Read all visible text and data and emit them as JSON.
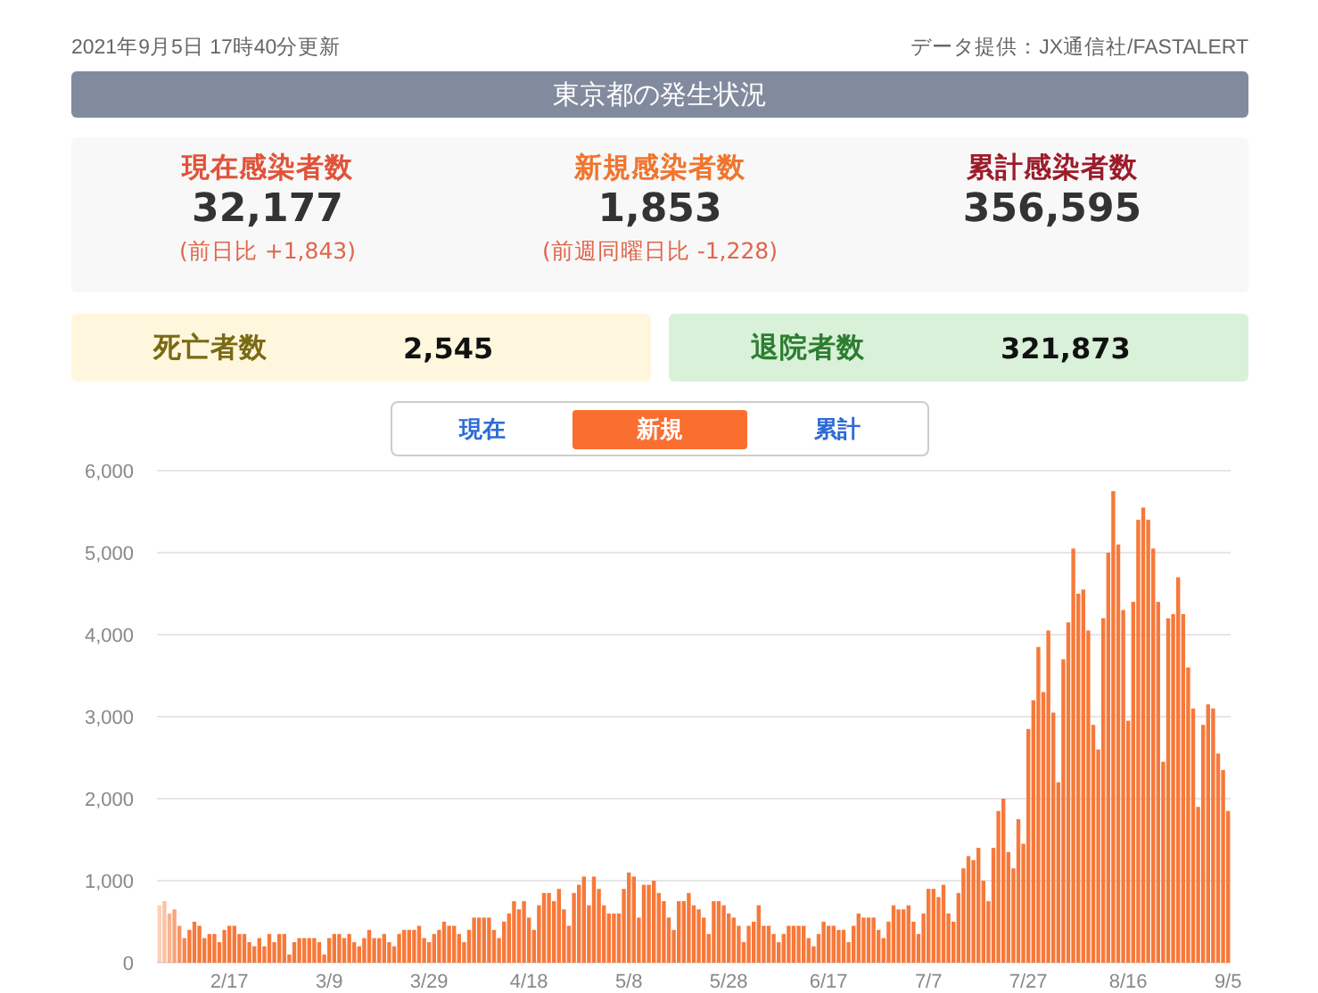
{
  "updated": "2021年9月5日 17時40分更新",
  "source": "データ提供：JX通信社/FASTALERT",
  "title": "東京都の発生状況",
  "stats": [
    {
      "kind": "active",
      "label": "現在感染者数",
      "value": "32,177",
      "note": "(前日比 +1,843)"
    },
    {
      "kind": "new",
      "label": "新規感染者数",
      "value": "1,853",
      "note": "(前週同曜日比 -1,228)"
    },
    {
      "kind": "total",
      "label": "累計感染者数",
      "value": "356,595"
    }
  ],
  "summary": [
    {
      "kind": "deaths",
      "label": "死亡者数",
      "value": "2,545"
    },
    {
      "kind": "discharged",
      "label": "退院者数",
      "value": "321,873"
    }
  ],
  "tabs": [
    {
      "label": "現在",
      "selected": false
    },
    {
      "label": "新規",
      "selected": true
    },
    {
      "label": "累計",
      "selected": false
    }
  ],
  "chart": {
    "chart_data": {
      "type": "bar",
      "grid": true,
      "ylim": [
        0,
        6000
      ],
      "yticks": [
        {
          "value": 0,
          "label": "0"
        },
        {
          "value": 1000,
          "label": "1,000"
        },
        {
          "value": 2000,
          "label": "2,000"
        },
        {
          "value": 3000,
          "label": "3,000"
        },
        {
          "value": 4000,
          "label": "4,000"
        },
        {
          "value": 5000,
          "label": "5,000"
        },
        {
          "value": 6000,
          "label": "6,000"
        }
      ],
      "categories": [
        null,
        null,
        null,
        null,
        null,
        null,
        null,
        null,
        null,
        null,
        null,
        null,
        null,
        null,
        "2/17",
        null,
        null,
        null,
        null,
        null,
        null,
        null,
        null,
        null,
        null,
        null,
        null,
        null,
        null,
        null,
        null,
        null,
        null,
        null,
        "3/9",
        null,
        null,
        null,
        null,
        null,
        null,
        null,
        null,
        null,
        null,
        null,
        null,
        null,
        null,
        null,
        null,
        null,
        null,
        null,
        "3/29",
        null,
        null,
        null,
        null,
        null,
        null,
        null,
        null,
        null,
        null,
        null,
        null,
        null,
        null,
        null,
        null,
        null,
        null,
        null,
        "4/18",
        null,
        null,
        null,
        null,
        null,
        null,
        null,
        null,
        null,
        null,
        null,
        null,
        null,
        null,
        null,
        null,
        null,
        null,
        null,
        "5/8",
        null,
        null,
        null,
        null,
        null,
        null,
        null,
        null,
        null,
        null,
        null,
        null,
        null,
        null,
        null,
        null,
        null,
        null,
        null,
        "5/28",
        null,
        null,
        null,
        null,
        null,
        null,
        null,
        null,
        null,
        null,
        null,
        null,
        null,
        null,
        null,
        null,
        null,
        null,
        null,
        "6/17",
        null,
        null,
        null,
        null,
        null,
        null,
        null,
        null,
        null,
        null,
        null,
        null,
        null,
        null,
        null,
        null,
        null,
        null,
        null,
        "7/7",
        null,
        null,
        null,
        null,
        null,
        null,
        null,
        null,
        null,
        null,
        null,
        null,
        null,
        null,
        null,
        null,
        null,
        null,
        null,
        "7/27",
        null,
        null,
        null,
        null,
        null,
        null,
        null,
        null,
        null,
        null,
        null,
        null,
        null,
        null,
        null,
        null,
        null,
        null,
        null,
        "8/16",
        null,
        null,
        null,
        null,
        null,
        null,
        null,
        null,
        null,
        null,
        null,
        null,
        null,
        null,
        null,
        null,
        null,
        null,
        null,
        "9/5"
      ],
      "series": [
        {
          "color": "#f7793a",
          "values": [
            700,
            750,
            600,
            650,
            450,
            300,
            400,
            500,
            450,
            300,
            350,
            350,
            250,
            400,
            450,
            450,
            350,
            350,
            250,
            200,
            300,
            200,
            350,
            250,
            350,
            350,
            100,
            250,
            300,
            300,
            300,
            300,
            250,
            100,
            300,
            350,
            350,
            300,
            350,
            250,
            200,
            300,
            400,
            300,
            300,
            350,
            250,
            200,
            350,
            400,
            400,
            400,
            450,
            300,
            250,
            350,
            400,
            500,
            450,
            450,
            350,
            250,
            400,
            550,
            550,
            550,
            550,
            400,
            300,
            500,
            600,
            750,
            650,
            750,
            550,
            400,
            700,
            850,
            850,
            750,
            900,
            650,
            450,
            850,
            950,
            1050,
            700,
            1050,
            900,
            700,
            600,
            600,
            600,
            900,
            1100,
            1050,
            550,
            950,
            950,
            1000,
            850,
            750,
            550,
            400,
            750,
            750,
            850,
            700,
            650,
            550,
            350,
            750,
            750,
            700,
            600,
            550,
            450,
            250,
            450,
            500,
            700,
            450,
            450,
            350,
            250,
            350,
            450,
            450,
            450,
            450,
            300,
            200,
            350,
            500,
            450,
            450,
            400,
            400,
            250,
            450,
            600,
            550,
            550,
            550,
            400,
            300,
            500,
            700,
            650,
            650,
            700,
            500,
            350,
            600,
            900,
            900,
            800,
            950,
            600,
            500,
            850,
            1150,
            1300,
            1250,
            1400,
            1000,
            750,
            1400,
            1850,
            2000,
            1350,
            1150,
            1750,
            1450,
            2850,
            3200,
            3850,
            3300,
            4050,
            3050,
            2200,
            3700,
            4150,
            5050,
            4500,
            4550,
            4050,
            2900,
            2600,
            4200,
            5000,
            5750,
            5100,
            4300,
            2950,
            4400,
            5400,
            5550,
            5400,
            5050,
            4400,
            2450,
            4200,
            4250,
            4700,
            4250,
            3600,
            3100,
            1900,
            2900,
            3150,
            3100,
            2550,
            2350,
            1850
          ]
        }
      ]
    }
  }
}
